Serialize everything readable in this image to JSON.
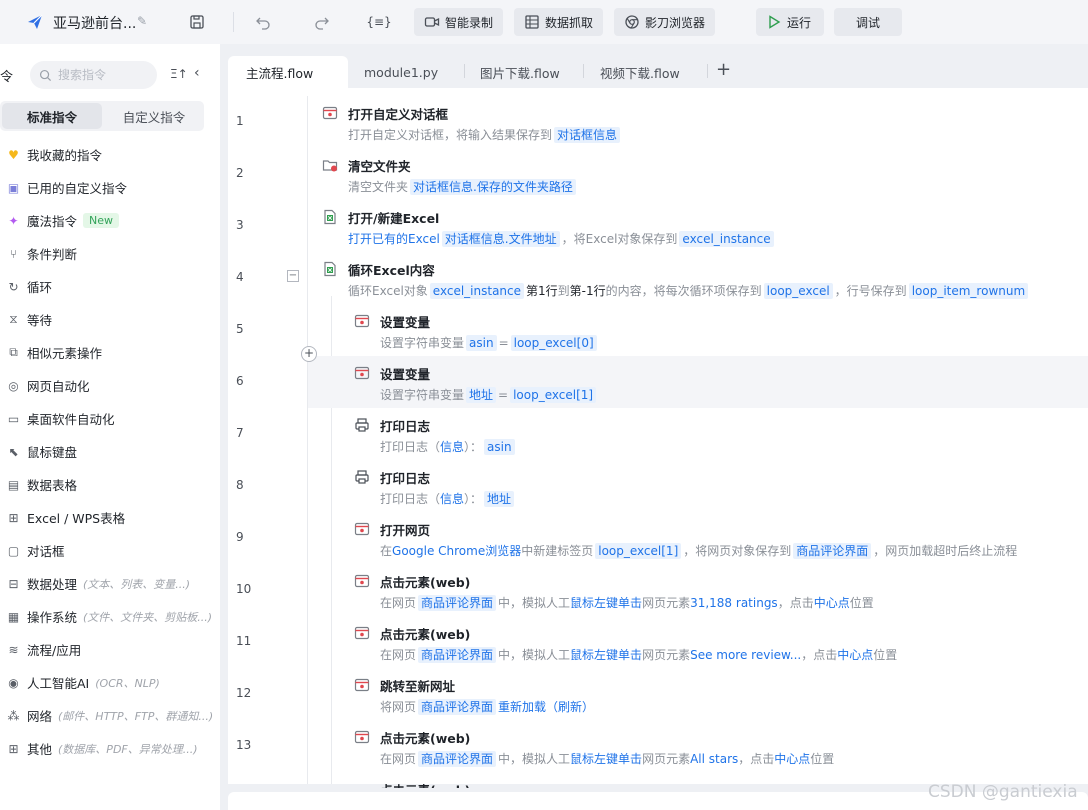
{
  "app": {
    "title": "亚马逊前台...",
    "toolbar": {
      "smart_record": "智能录制",
      "data_capture": "数据抓取",
      "browser": "影刀浏览器",
      "run": "运行",
      "debug": "调试"
    }
  },
  "sidebar": {
    "header_label": "令",
    "search_placeholder": "搜索指令",
    "seg_standard": "标准指令",
    "seg_custom": "自定义指令",
    "categories": [
      {
        "label": "我收藏的指令",
        "icon": "heart-icon"
      },
      {
        "label": "已用的自定义指令",
        "icon": "box-icon"
      },
      {
        "label": "魔法指令",
        "icon": "sparkle-icon",
        "badge": "New"
      },
      {
        "label": "条件判断",
        "icon": "branch-icon"
      },
      {
        "label": "循环",
        "icon": "loop-icon"
      },
      {
        "label": "等待",
        "icon": "hourglass-icon"
      },
      {
        "label": "相似元素操作",
        "icon": "similar-icon"
      },
      {
        "label": "网页自动化",
        "icon": "web-icon"
      },
      {
        "label": "桌面软件自动化",
        "icon": "desktop-icon"
      },
      {
        "label": "鼠标键盘",
        "icon": "mouse-icon"
      },
      {
        "label": "数据表格",
        "icon": "table-icon"
      },
      {
        "label": "Excel / WPS表格",
        "icon": "excel-icon"
      },
      {
        "label": "对话框",
        "icon": "dialog-icon"
      },
      {
        "label": "数据处理",
        "icon": "data-icon",
        "hint": "(文本、列表、变量...)"
      },
      {
        "label": "操作系统",
        "icon": "os-icon",
        "hint": "(文件、文件夹、剪贴板...)"
      },
      {
        "label": "流程/应用",
        "icon": "layers-icon"
      },
      {
        "label": "人工智能AI",
        "icon": "ai-icon",
        "hint": "(OCR、NLP)"
      },
      {
        "label": "网络",
        "icon": "network-icon",
        "hint": "(邮件、HTTP、FTP、群通知...)"
      },
      {
        "label": "其他",
        "icon": "grid-icon",
        "hint": "(数据库、PDF、异常处理...)"
      }
    ]
  },
  "tabs": [
    "主流程.flow",
    "module1.py",
    "图片下载.flow",
    "视频下载.flow"
  ],
  "line_numbers": [
    "1",
    "2",
    "3",
    "4",
    "5",
    "6",
    "7",
    "8",
    "9",
    "10",
    "11",
    "12",
    "13"
  ],
  "steps": [
    {
      "title": "打开自定义对话框",
      "desc": [
        [
          "t",
          "打开自定义对话框，将输入结果保存到"
        ],
        [
          "v",
          "对话框信息"
        ]
      ]
    },
    {
      "title": "清空文件夹",
      "desc": [
        [
          "t",
          "清空文件夹"
        ],
        [
          "v",
          "对话框信息.保存的文件夹路径"
        ]
      ]
    },
    {
      "title": "打开/新建Excel",
      "desc": [
        [
          "b",
          "打开已有的Excel"
        ],
        [
          "v",
          "对话框信息.文件地址"
        ],
        [
          "t",
          "，将Excel对象保存到"
        ],
        [
          "v",
          "excel_instance"
        ]
      ]
    },
    {
      "title": "循环Excel内容",
      "desc": [
        [
          "t",
          "循环Excel对象"
        ],
        [
          "v",
          "excel_instance"
        ],
        [
          "k",
          "第1行"
        ],
        [
          "t",
          "到"
        ],
        [
          "k",
          "第-1行"
        ],
        [
          "t",
          "的内容，将每次循环项保存到"
        ],
        [
          "v",
          "loop_excel"
        ],
        [
          "t",
          "，行号保存到"
        ],
        [
          "v",
          "loop_item_rownum"
        ]
      ]
    },
    {
      "title": "设置变量",
      "desc": [
        [
          "t",
          "设置字符串变量"
        ],
        [
          "v",
          "asin"
        ],
        [
          "t",
          "="
        ],
        [
          "v",
          "loop_excel[0]"
        ]
      ]
    },
    {
      "title": "设置变量",
      "desc": [
        [
          "t",
          "设置字符串变量"
        ],
        [
          "v",
          "地址"
        ],
        [
          "t",
          "="
        ],
        [
          "v",
          "loop_excel[1]"
        ]
      ]
    },
    {
      "title": "打印日志",
      "desc": [
        [
          "t",
          "打印日志（"
        ],
        [
          "b",
          "信息"
        ],
        [
          "t",
          "）："
        ],
        [
          "v",
          "asin"
        ]
      ]
    },
    {
      "title": "打印日志",
      "desc": [
        [
          "t",
          "打印日志（"
        ],
        [
          "b",
          "信息"
        ],
        [
          "t",
          "）："
        ],
        [
          "v",
          "地址"
        ]
      ]
    },
    {
      "title": "打开网页",
      "desc": [
        [
          "t",
          "在"
        ],
        [
          "b",
          "Google Chrome浏览器"
        ],
        [
          "t",
          "中新建标签页"
        ],
        [
          "v",
          "loop_excel[1]"
        ],
        [
          "t",
          "，将网页对象保存到"
        ],
        [
          "v",
          "商品评论界面"
        ],
        [
          "t",
          "，网页加载超时后终止流程"
        ]
      ]
    },
    {
      "title": "点击元素(web)",
      "desc": [
        [
          "t",
          "在网页"
        ],
        [
          "v",
          "商品评论界面"
        ],
        [
          "t",
          "中，模拟人工"
        ],
        [
          "b",
          "鼠标左键单击"
        ],
        [
          "t",
          "网页元素"
        ],
        [
          "b",
          "31,188 ratings"
        ],
        [
          "t",
          "，点击"
        ],
        [
          "b",
          "中心点"
        ],
        [
          "t",
          "位置"
        ]
      ]
    },
    {
      "title": "点击元素(web)",
      "desc": [
        [
          "t",
          "在网页"
        ],
        [
          "v",
          "商品评论界面"
        ],
        [
          "t",
          "中，模拟人工"
        ],
        [
          "b",
          "鼠标左键单击"
        ],
        [
          "t",
          "网页元素"
        ],
        [
          "b",
          "See more review..."
        ],
        [
          "t",
          "，点击"
        ],
        [
          "b",
          "中心点"
        ],
        [
          "t",
          "位置"
        ]
      ]
    },
    {
      "title": "跳转至新网址",
      "desc": [
        [
          "t",
          "将网页"
        ],
        [
          "v",
          "商品评论界面"
        ],
        [
          "b",
          "重新加载（刷新）"
        ]
      ]
    },
    {
      "title": "点击元素(web)",
      "desc": [
        [
          "t",
          "在网页"
        ],
        [
          "v",
          "商品评论界面"
        ],
        [
          "t",
          "中，模拟人工"
        ],
        [
          "b",
          "鼠标左键单击"
        ],
        [
          "t",
          "网页元素"
        ],
        [
          "b",
          "All stars"
        ],
        [
          "t",
          "，点击"
        ],
        [
          "b",
          "中心点"
        ],
        [
          "t",
          "位置"
        ]
      ]
    }
  ],
  "truncated_step_title": "点击元素(web)",
  "watermark": "CSDN @gantiexia"
}
